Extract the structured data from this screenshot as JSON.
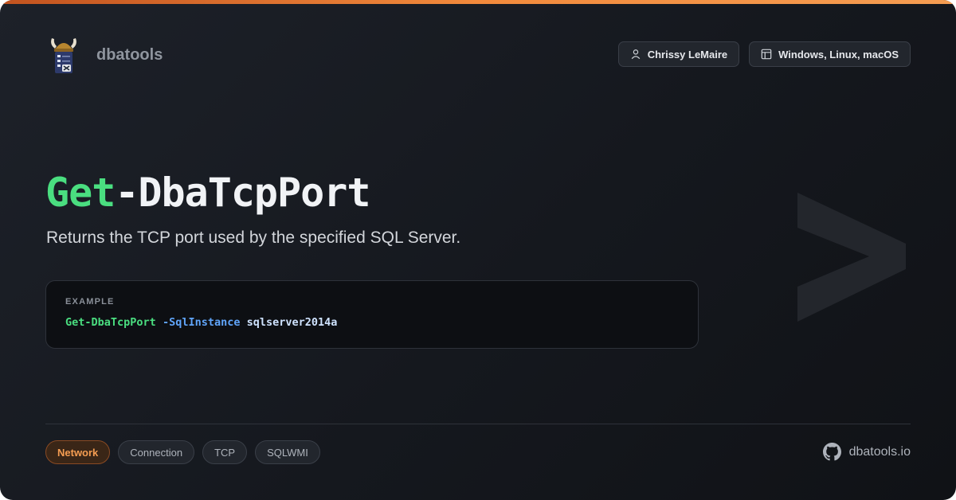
{
  "brand": {
    "name": "dbatools",
    "logo_icon": "viking-server-logo-icon"
  },
  "header": {
    "author": {
      "icon": "user-icon",
      "label": "Chrissy LeMaire"
    },
    "platforms": {
      "icon": "window-icon",
      "label": "Windows, Linux, macOS"
    }
  },
  "command": {
    "verb": "Get",
    "noun": "-DbaTcpPort",
    "description": "Returns the TCP port used by the specified SQL Server."
  },
  "example": {
    "label": "EXAMPLE",
    "command": "Get-DbaTcpPort",
    "parameter": "-SqlInstance",
    "value": "sqlserver2014a"
  },
  "tags": [
    "Network",
    "Connection",
    "TCP",
    "SQLWMI"
  ],
  "footer": {
    "icon": "github-icon",
    "site": "dbatools.io"
  },
  "colors": {
    "accent": "#f28a3c",
    "verb": "#4ade80",
    "param": "#60a5fa",
    "background": "#181b21"
  }
}
